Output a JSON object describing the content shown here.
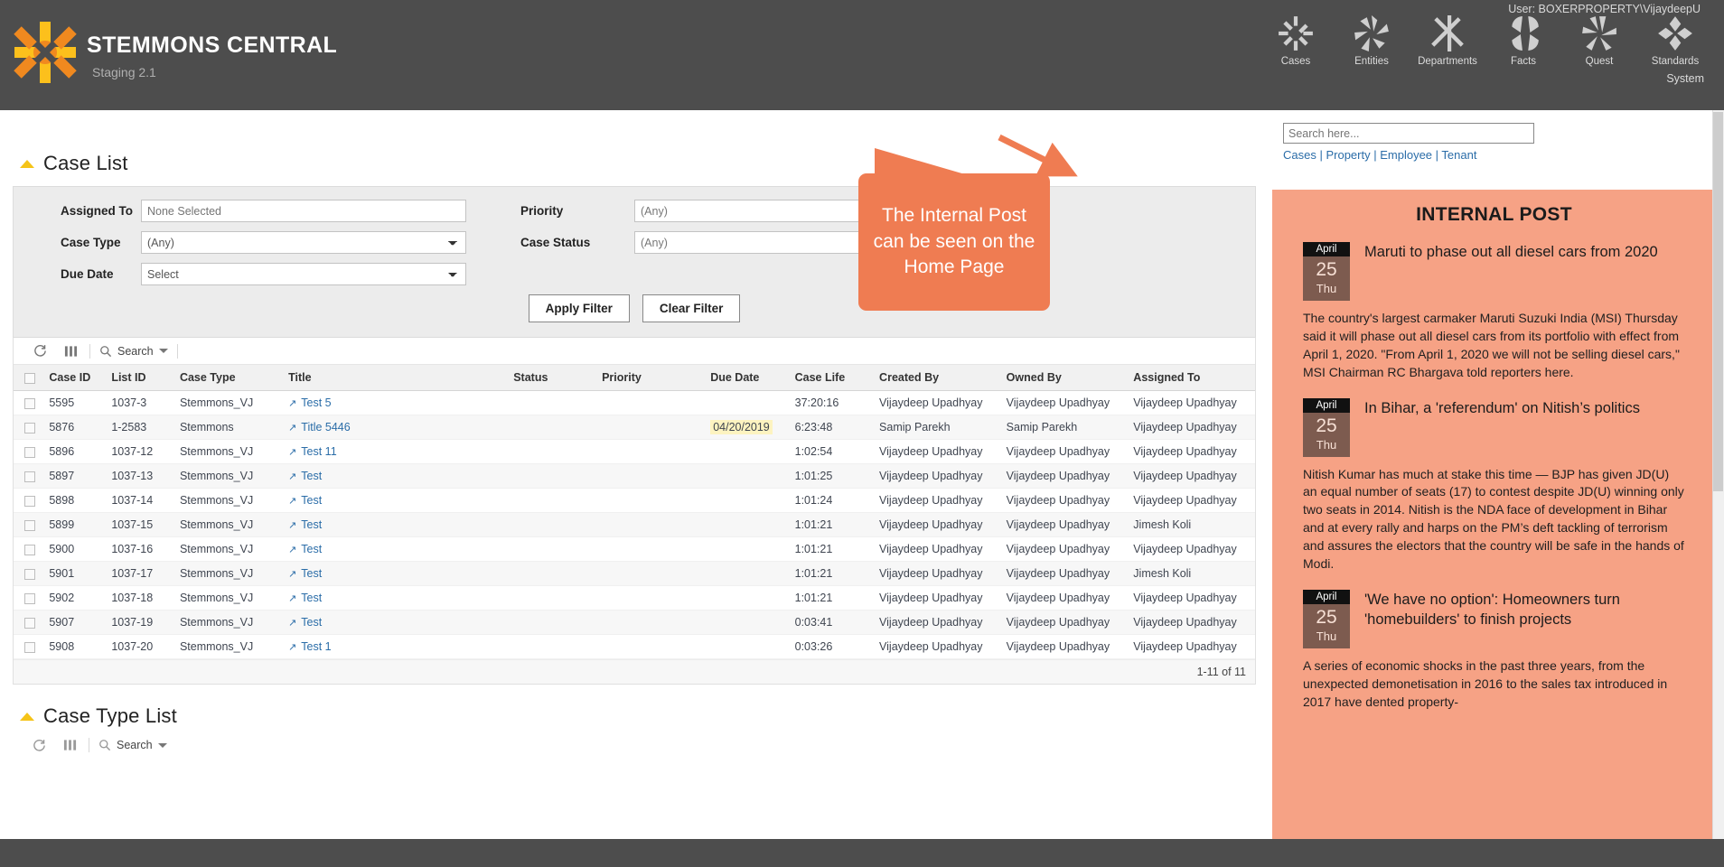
{
  "header": {
    "brand_title": "STEMMONS CENTRAL",
    "brand_sub": "Staging 2.1",
    "logo_name": "stemmons-sunburst-logo",
    "user_label": "User: BOXERPROPERTY\\VijaydeepU",
    "system_label": "System",
    "nav": [
      {
        "label": "Cases",
        "icon": "sunburst-cases-icon"
      },
      {
        "label": "Entities",
        "icon": "sunburst-entities-icon"
      },
      {
        "label": "Departments",
        "icon": "sunburst-departments-icon"
      },
      {
        "label": "Facts",
        "icon": "sunburst-facts-icon"
      },
      {
        "label": "Quest",
        "icon": "sunburst-quest-icon"
      },
      {
        "label": "Standards",
        "icon": "sunburst-standards-icon"
      }
    ]
  },
  "case_list": {
    "title": "Case List",
    "filters": {
      "assigned_to_label": "Assigned To",
      "assigned_to_placeholder": "None Selected",
      "assigned_to_value": "",
      "case_type_label": "Case Type",
      "case_type_value": "(Any)",
      "due_date_label": "Due Date",
      "due_date_value": "Select",
      "priority_label": "Priority",
      "priority_value": "(Any)",
      "case_status_label": "Case Status",
      "case_status_value": "(Any)",
      "apply_label": "Apply Filter",
      "clear_label": "Clear Filter"
    },
    "toolbar": {
      "refresh_icon": "refresh-icon",
      "columns_icon": "column-chooser-icon",
      "search_icon": "search-icon",
      "search_label": "Search"
    },
    "columns": [
      "Case ID",
      "List ID",
      "Case Type",
      "Title",
      "Status",
      "Priority",
      "Due Date",
      "Case Life",
      "Created By",
      "Owned By",
      "Assigned To"
    ],
    "rows": [
      {
        "case_id": "5595",
        "list_id": "1037-3",
        "case_type": "Stemmons_VJ",
        "title": "Test 5",
        "status": "",
        "priority": "",
        "due_date": "",
        "due_hl": false,
        "case_life": "37:20:16",
        "created_by": "Vijaydeep Upadhyay",
        "owned_by": "Vijaydeep Upadhyay",
        "assigned_to": "Vijaydeep Upadhyay"
      },
      {
        "case_id": "5876",
        "list_id": "1-2583",
        "case_type": "Stemmons",
        "title": "Title 5446",
        "status": "",
        "priority": "",
        "due_date": "04/20/2019",
        "due_hl": true,
        "case_life": "6:23:48",
        "created_by": "Samip Parekh",
        "owned_by": "Samip Parekh",
        "assigned_to": "Vijaydeep Upadhyay"
      },
      {
        "case_id": "5896",
        "list_id": "1037-12",
        "case_type": "Stemmons_VJ",
        "title": "Test 11",
        "status": "",
        "priority": "",
        "due_date": "",
        "due_hl": false,
        "case_life": "1:02:54",
        "created_by": "Vijaydeep Upadhyay",
        "owned_by": "Vijaydeep Upadhyay",
        "assigned_to": "Vijaydeep Upadhyay"
      },
      {
        "case_id": "5897",
        "list_id": "1037-13",
        "case_type": "Stemmons_VJ",
        "title": "Test",
        "status": "",
        "priority": "",
        "due_date": "",
        "due_hl": false,
        "case_life": "1:01:25",
        "created_by": "Vijaydeep Upadhyay",
        "owned_by": "Vijaydeep Upadhyay",
        "assigned_to": "Vijaydeep Upadhyay"
      },
      {
        "case_id": "5898",
        "list_id": "1037-14",
        "case_type": "Stemmons_VJ",
        "title": "Test",
        "status": "",
        "priority": "",
        "due_date": "",
        "due_hl": false,
        "case_life": "1:01:24",
        "created_by": "Vijaydeep Upadhyay",
        "owned_by": "Vijaydeep Upadhyay",
        "assigned_to": "Vijaydeep Upadhyay"
      },
      {
        "case_id": "5899",
        "list_id": "1037-15",
        "case_type": "Stemmons_VJ",
        "title": "Test",
        "status": "",
        "priority": "",
        "due_date": "",
        "due_hl": false,
        "case_life": "1:01:21",
        "created_by": "Vijaydeep Upadhyay",
        "owned_by": "Vijaydeep Upadhyay",
        "assigned_to": "Jimesh Koli"
      },
      {
        "case_id": "5900",
        "list_id": "1037-16",
        "case_type": "Stemmons_VJ",
        "title": "Test",
        "status": "",
        "priority": "",
        "due_date": "",
        "due_hl": false,
        "case_life": "1:01:21",
        "created_by": "Vijaydeep Upadhyay",
        "owned_by": "Vijaydeep Upadhyay",
        "assigned_to": "Vijaydeep Upadhyay"
      },
      {
        "case_id": "5901",
        "list_id": "1037-17",
        "case_type": "Stemmons_VJ",
        "title": "Test",
        "status": "",
        "priority": "",
        "due_date": "",
        "due_hl": false,
        "case_life": "1:01:21",
        "created_by": "Vijaydeep Upadhyay",
        "owned_by": "Vijaydeep Upadhyay",
        "assigned_to": "Jimesh Koli"
      },
      {
        "case_id": "5902",
        "list_id": "1037-18",
        "case_type": "Stemmons_VJ",
        "title": "Test",
        "status": "",
        "priority": "",
        "due_date": "",
        "due_hl": false,
        "case_life": "1:01:21",
        "created_by": "Vijaydeep Upadhyay",
        "owned_by": "Vijaydeep Upadhyay",
        "assigned_to": "Vijaydeep Upadhyay"
      },
      {
        "case_id": "5907",
        "list_id": "1037-19",
        "case_type": "Stemmons_VJ",
        "title": "Test",
        "status": "",
        "priority": "",
        "due_date": "",
        "due_hl": false,
        "case_life": "0:03:41",
        "created_by": "Vijaydeep Upadhyay",
        "owned_by": "Vijaydeep Upadhyay",
        "assigned_to": "Vijaydeep Upadhyay"
      },
      {
        "case_id": "5908",
        "list_id": "1037-20",
        "case_type": "Stemmons_VJ",
        "title": "Test 1",
        "status": "",
        "priority": "",
        "due_date": "",
        "due_hl": false,
        "case_life": "0:03:26",
        "created_by": "Vijaydeep Upadhyay",
        "owned_by": "Vijaydeep Upadhyay",
        "assigned_to": "Vijaydeep Upadhyay"
      }
    ],
    "pager": "1-11 of 11"
  },
  "case_type_list": {
    "title": "Case Type List",
    "toolbar": {
      "search_label": "Search"
    }
  },
  "right_panel": {
    "search_placeholder": "Search here...",
    "search_value": "",
    "links": [
      "Cases",
      "Property",
      "Employee",
      "Tenant"
    ],
    "panel_title": "INTERNAL POST",
    "posts": [
      {
        "month": "April",
        "day": "25",
        "weekday": "Thu",
        "title": "Maruti to phase out all diesel cars from 2020",
        "body": "The country's largest carmaker Maruti Suzuki India (MSI) Thursday said it will phase out all diesel cars from its portfolio with effect from April 1, 2020. \"From April 1, 2020 we will not be selling diesel cars,\" MSI Chairman RC Bhargava told reporters here."
      },
      {
        "month": "April",
        "day": "25",
        "weekday": "Thu",
        "title": "In Bihar, a 'referendum' on Nitish’s politics",
        "body": "Nitish Kumar has much at stake this time — BJP has given JD(U) an equal number of seats (17) to contest despite JD(U) winning only two seats in 2014. Nitish is the NDA face of development in Bihar and at every rally and harps on the PM’s deft tackling of terrorism and assures the electors that the country will be safe in the hands of Modi."
      },
      {
        "month": "April",
        "day": "25",
        "weekday": "Thu",
        "title": "'We have no option': Homeowners turn 'homebuilders' to finish projects",
        "body": "A series of economic shocks in the past three years, from the unexpected demonetisation in 2016 to the sales tax introduced in 2017 have dented property-"
      }
    ]
  },
  "callout": {
    "text": "The Internal Post can be seen on the Home Page",
    "color": "#ef7c52"
  },
  "colors": {
    "header_bg": "#4d4d4d",
    "accent_orange": "#ef7c52",
    "panel_peach": "#f6a285",
    "logo_orange": "#f0891f",
    "logo_yellow": "#fcc01c",
    "link_blue": "#2b6da8",
    "triangle_yellow": "#f5c418",
    "due_highlight": "#fdf3c0"
  }
}
